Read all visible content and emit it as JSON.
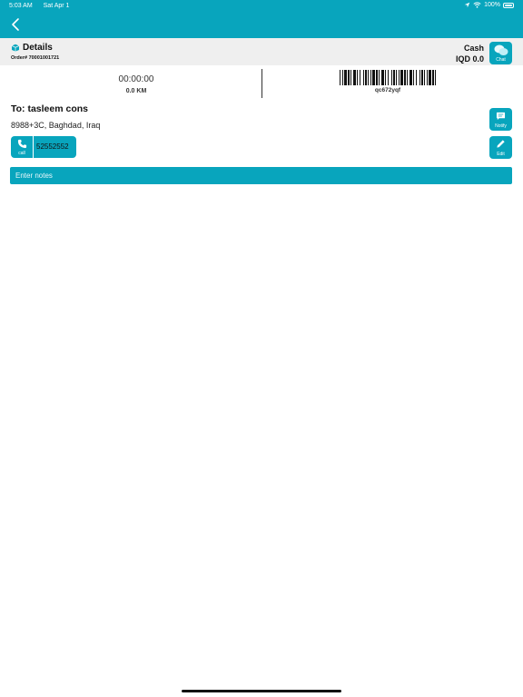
{
  "status_bar": {
    "time": "5:03 AM",
    "date": "Sat Apr 1",
    "battery": "100%"
  },
  "header": {
    "back_icon": "chevron-left-icon"
  },
  "details": {
    "title": "Details",
    "order_number": "Order# 70001001721",
    "payment_method": "Cash",
    "payment_amount": "IQD 0.0",
    "chat_label": "Chat"
  },
  "tracking": {
    "timer": "00:00:00",
    "distance": "0.0 KM",
    "barcode_text": "qc672yqf"
  },
  "recipient": {
    "name": "To: tasleem cons",
    "address": "8988+3C, Baghdad, Iraq",
    "call_label": "call",
    "phone": "52552552",
    "notify_label": "Notify",
    "edit_label": "Edit"
  },
  "notes": {
    "placeholder": "Enter notes",
    "value": ""
  },
  "colors": {
    "accent": "#08a5bd",
    "details_bg": "#efefef"
  }
}
